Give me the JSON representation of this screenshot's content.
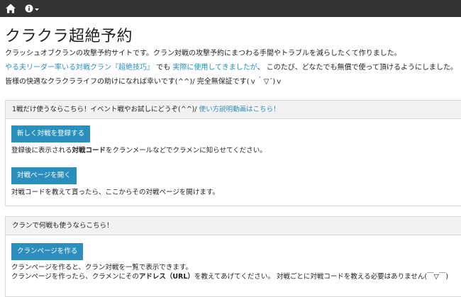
{
  "nav": {
    "home_icon": "home-icon",
    "info_icon": "info-circle-icon"
  },
  "title": "クラクラ超絶予約",
  "intro": {
    "line1": "クラッシュオブクランの攻撃予約サイトです。クラン対戦の攻撃予約にまつわる手間やトラブルを減らしたくて作りました。",
    "line2_link1": "やる夫リーダー率いる対戦クラン『超絶技巧』",
    "line2_mid": " でも ",
    "line2_link2": "実際に使用してきましたが",
    "line2_end": "、 このたび、どなたでも無償で使って頂けるようにしました。",
    "line3": "皆様の快適なクラクラライフの助けになれば幸いです(^^)/ 完全無保証です(ｖ｀▽´)ｖ"
  },
  "panel1": {
    "header_text": "1戦だけ使うならこちら！イベント戦やお試しにどうぞ(^^)/ ",
    "header_link": "使い方説明動画はこちら！",
    "register_button": "新しく対戦を登録する",
    "register_desc_pre": "登録後に表示される",
    "register_desc_bold": "対戦コード",
    "register_desc_post": "をクランメールなどでクラメンに知らせてください。",
    "open_button": "対戦ページを開く",
    "open_desc": "対戦コードを教えて貰ったら、ここからその対戦ページを開けます。"
  },
  "panel2": {
    "header_text": "クランで何戦も使うならこちら！",
    "clan_button": "クランページを作る",
    "desc1": "クランページを作ると、クラン対戦を一覧で表示できます。",
    "desc2_pre": "クランページを作ったら、クラメンにその",
    "desc2_bold": "アドレス（URL）",
    "desc2_post": "を教えてあげてください。 対戦ごとに対戦コードを教える必要はありません(￣▽￣)"
  }
}
